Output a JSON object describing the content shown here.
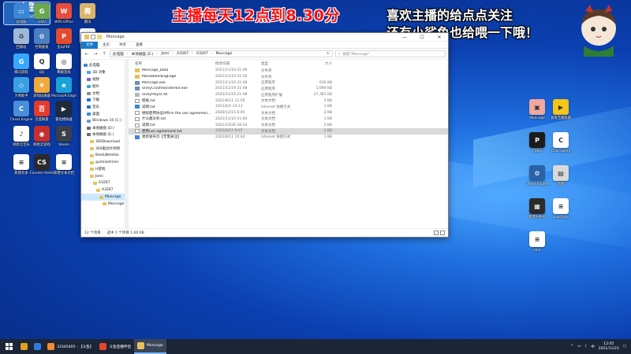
{
  "overlay": {
    "red_banner": "主播每天12点到8.30分",
    "line1": "喜欢主播的给点点关注",
    "line2": "还有小鲨鱼也给喂一下哦！",
    "logo_top": "斗鱼",
    "logo_id": "3039604"
  },
  "desktop_left": [
    {
      "label": "此电脑",
      "color": "#3b86d6",
      "glyph": "▭"
    },
    {
      "label": "GNU",
      "color": "#6aa84f",
      "glyph": "G"
    },
    {
      "label": "WPS Office",
      "color": "#e74c3c",
      "glyph": "W"
    },
    {
      "label": "腾讯",
      "color": "#d9b56d",
      "glyph": "腾"
    },
    {
      "label": "回收站",
      "color": "#9fb8d8",
      "glyph": "♻"
    },
    {
      "label": "控制面板",
      "color": "#4a7fc1",
      "glyph": "⚙"
    },
    {
      "label": "金山PDF",
      "color": "#e44b2f",
      "glyph": "P"
    },
    {
      "label": "飞书",
      "color": "#ffffff",
      "glyph": "✈"
    },
    {
      "label": "腾讯游戏",
      "color": "#37a7ff",
      "glyph": "G"
    },
    {
      "label": "QQ",
      "color": "#ffffff",
      "glyph": "Q"
    },
    {
      "label": "鹰眼游戏",
      "color": "#ffffff",
      "glyph": "◎"
    },
    {
      "label": "大师助手",
      "color": "#39a0e6",
      "glyph": "◇"
    },
    {
      "label": "游戏加速器",
      "color": "#f2a93b",
      "glyph": "❖"
    },
    {
      "label": "Microsoft Edge",
      "color": "#1aa3d9",
      "glyph": "e"
    },
    {
      "label": "Cheat Engine",
      "color": "#4a8ed8",
      "glyph": "C"
    },
    {
      "label": "百度网盘",
      "color": "#e33b2f",
      "glyph": "百"
    },
    {
      "label": "雷电模拟器",
      "color": "#1f2a3a",
      "glyph": "▶"
    },
    {
      "label": "网易云音乐",
      "color": "#ffffff",
      "glyph": "♪"
    },
    {
      "label": "网易云游戏",
      "color": "#c62f2f",
      "glyph": "◉"
    },
    {
      "label": "Steam",
      "color": "#39404a",
      "glyph": "S"
    },
    {
      "label": "新建文本",
      "color": "#ffffff",
      "glyph": "≡"
    },
    {
      "label": "Counter-Strike",
      "color": "#2a2a2a",
      "glyph": "CS"
    },
    {
      "label": "新建文本文档",
      "color": "#ffffff",
      "glyph": "≡"
    }
  ],
  "desktop_right": [
    {
      "label": "Moncage",
      "color": "#f0a8a0",
      "glyph": "▣"
    },
    {
      "label": "爱奇艺播放器",
      "color": "#f5c518",
      "glyph": "▶"
    },
    {
      "label": "PUBG",
      "color": "#1b1b1b",
      "glyph": "P"
    },
    {
      "label": "Crab Game",
      "color": "#ffffff",
      "glyph": "C"
    },
    {
      "label": "Cheat Engine",
      "color": "#2a62a8",
      "glyph": "⚙"
    },
    {
      "label": "新建",
      "color": "#d9d9d9",
      "glyph": "▤"
    },
    {
      "label": "新建文件夹",
      "color": "#2b2b2b",
      "glyph": "▦"
    },
    {
      "label": "yousfanyi",
      "color": "#ffffff",
      "glyph": "≡"
    },
    {
      "label": "Hop",
      "color": "#ffffff",
      "glyph": "≡"
    }
  ],
  "explorer": {
    "title": "Moncage",
    "ribbon_tabs": [
      "文件",
      "主页",
      "共享",
      "查看"
    ],
    "breadcrumb": [
      "此电脑",
      "本地磁盘 (E:)",
      "Jemi",
      "A3267",
      "A3267",
      "Moncage"
    ],
    "search_placeholder": "搜索\"Moncage\"",
    "nav_items": [
      {
        "label": "此电脑",
        "color": "#3b86d6",
        "indent": 0
      },
      {
        "label": "3D 对象",
        "color": "#5aa0e0",
        "indent": 4
      },
      {
        "label": "视频",
        "color": "#7b5fd1",
        "indent": 4
      },
      {
        "label": "图片",
        "color": "#3fa6d8",
        "indent": 4
      },
      {
        "label": "文档",
        "color": "#8c8c8c",
        "indent": 4
      },
      {
        "label": "下载",
        "color": "#1e73c8",
        "indent": 4
      },
      {
        "label": "音乐",
        "color": "#1e73c8",
        "indent": 4
      },
      {
        "label": "桌面",
        "color": "#2f8ad6",
        "indent": 4
      },
      {
        "label": "Windows 10 (C:)",
        "color": "#6b9bd1",
        "indent": 4
      },
      {
        "label": "本地磁盘 (D:)",
        "color": "#6b6b6b",
        "indent": 4
      },
      {
        "label": "本地磁盘 (E:)",
        "color": "#6b6b6b",
        "indent": 4
      },
      {
        "label": "360Download",
        "color": "#e8c15a",
        "indent": 8
      },
      {
        "label": "360驱动大师目",
        "color": "#e8c15a",
        "indent": 8
      },
      {
        "label": "BaiduNetdisk",
        "color": "#e8c15a",
        "indent": 8
      },
      {
        "label": "guimiezhiren",
        "color": "#e8c15a",
        "indent": 8
      },
      {
        "label": "H游戏",
        "color": "#e8c15a",
        "indent": 8
      },
      {
        "label": "Jemi",
        "color": "#e8c15a",
        "indent": 8
      },
      {
        "label": "A3267",
        "color": "#e8c15a",
        "indent": 12
      },
      {
        "label": "A3267",
        "color": "#e8c15a",
        "indent": 16
      },
      {
        "label": "Moncage",
        "color": "#e8c15a",
        "indent": 20,
        "selected": true
      },
      {
        "label": "Moncage",
        "color": "#e8c15a",
        "indent": 24
      }
    ],
    "columns": {
      "name": "名称",
      "date": "修改日期",
      "type": "类型",
      "size": "大小"
    },
    "files": [
      {
        "name": "Moncage_Data",
        "date": "2021/11/19 21:49",
        "type": "文件夹",
        "size": "",
        "icon": "folder"
      },
      {
        "name": "MonoBleedingEdge",
        "date": "2021/11/19 21:50",
        "type": "文件夹",
        "size": "",
        "icon": "folder"
      },
      {
        "name": "Moncage.exe",
        "date": "2021/11/19 21:48",
        "type": "应用程序",
        "size": "636 KB",
        "icon": "exe"
      },
      {
        "name": "UnityCrashHandler64.exe",
        "date": "2021/11/19 21:48",
        "type": "应用程序",
        "size": "1,090 KB",
        "icon": "exe"
      },
      {
        "name": "UnityPlayer.dll",
        "date": "2021/11/19 21:48",
        "type": "应用程序扩展",
        "size": "27,361 KB",
        "icon": "dll"
      },
      {
        "name": "壁纸.txt",
        "date": "2021/8/11 11:50",
        "type": "文本文档",
        "size": "1 KB",
        "icon": "txt"
      },
      {
        "name": "说明.txt",
        "date": "2021/4/2 14:13",
        "type": "Internet 快捷方式",
        "size": "1 KB",
        "icon": "url"
      },
      {
        "name": "继续使用协议Affirm the use agreemen...",
        "date": "2020/12/15 6:05",
        "type": "文本文档",
        "size": "2 KB",
        "icon": "txt"
      },
      {
        "name": "什么都没有.txt",
        "date": "2021/11/10 11:00",
        "type": "文本文档",
        "size": "1 KB",
        "icon": "txt"
      },
      {
        "name": "说明.txt",
        "date": "2021/10/26 16:24",
        "type": "文本文档",
        "size": "2 KB",
        "icon": "txt"
      },
      {
        "name": "使用use agreement.txt",
        "date": "2021/6/11 9:07",
        "type": "文本文档",
        "size": "2 KB",
        "icon": "txt",
        "selected": true
      },
      {
        "name": "更新发布页【无需关注】",
        "date": "2021/8/11 10:44",
        "type": "Internet 快捷方式",
        "size": "1 KB",
        "icon": "url"
      }
    ],
    "status_count": "12 个项目",
    "status_selected": "选中 1 个项目  1.60 KB"
  },
  "taskbar": {
    "buttons": [
      {
        "label": "",
        "color": "#e0a020",
        "active": false
      },
      {
        "label": "",
        "color": "#2c7be5",
        "active": false
      },
      {
        "label": "33345405 - 【斗鱼】",
        "color": "#f28b30",
        "active": false
      },
      {
        "label": "斗鱼直播伴侣",
        "color": "#e0482a",
        "active": false
      },
      {
        "label": "Moncage",
        "color": "#e8c15a",
        "active": true
      }
    ],
    "time": "12:05",
    "date": "2021/11/23"
  }
}
